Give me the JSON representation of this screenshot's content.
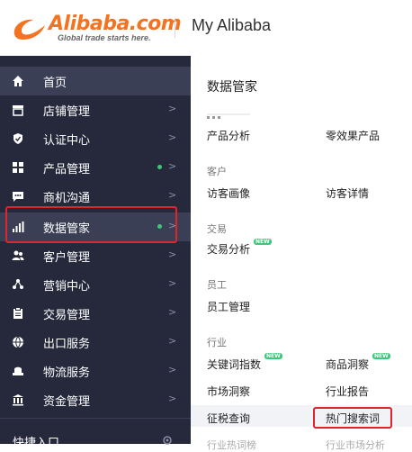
{
  "header": {
    "logo_word": "Alibaba.com",
    "logo_tagline": "Global trade starts here.",
    "title": "My Alibaba"
  },
  "sidebar": {
    "items": [
      {
        "label": "首页",
        "icon": "home-icon",
        "active": true
      },
      {
        "label": "店铺管理",
        "icon": "store-icon"
      },
      {
        "label": "认证中心",
        "icon": "shield-icon"
      },
      {
        "label": "产品管理",
        "icon": "grid-icon",
        "dot": true
      },
      {
        "label": "商机沟通",
        "icon": "chat-icon"
      },
      {
        "label": "数据管家",
        "icon": "bar-chart-icon",
        "dot": true,
        "highlighted": true
      },
      {
        "label": "客户管理",
        "icon": "users-icon"
      },
      {
        "label": "营销中心",
        "icon": "marketing-icon"
      },
      {
        "label": "交易管理",
        "icon": "clipboard-icon"
      },
      {
        "label": "出口服务",
        "icon": "globe-icon"
      },
      {
        "label": "物流服务",
        "icon": "truck-icon"
      },
      {
        "label": "资金管理",
        "icon": "bank-icon"
      }
    ],
    "arrow": ">",
    "quick_entry": "快捷入口"
  },
  "panel": {
    "title": "数据管家",
    "groups": [
      {
        "category": "",
        "links": [
          "产品分析",
          "零效果产品"
        ]
      },
      {
        "category": "客户",
        "links": [
          "访客画像",
          "访客详情"
        ]
      },
      {
        "category": "交易",
        "links": [
          "交易分析"
        ]
      },
      {
        "category": "员工",
        "links": [
          "员工管理"
        ]
      },
      {
        "category": "行业",
        "links": [
          "关键词指数",
          "商品洞察",
          "市场洞察",
          "行业报告",
          "征税查询",
          "热门搜索词"
        ]
      }
    ],
    "new_badge": "NEW",
    "ghost_left": "行业热词榜",
    "ghost_right": "行业市场分析"
  },
  "colors": {
    "sidebar_bg": "#26293c",
    "active_bg": "#3b3f56",
    "dot": "#3ec77a",
    "highlight_border": "#e0242b",
    "brand": "#f47321"
  }
}
